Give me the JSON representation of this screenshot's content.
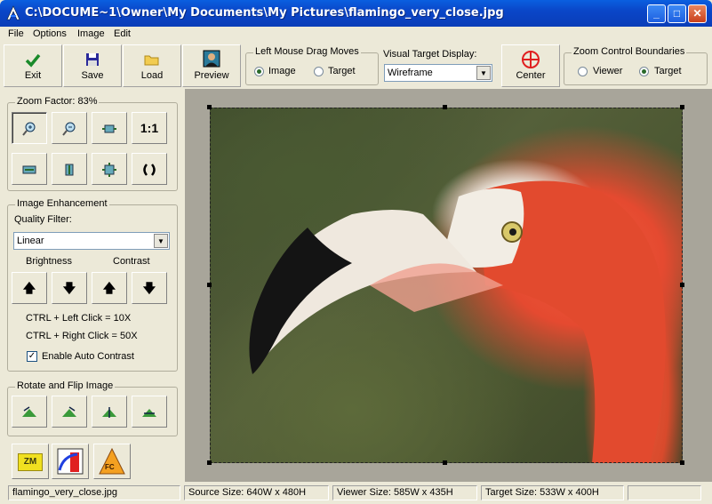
{
  "window": {
    "title": "C:\\DOCUME~1\\Owner\\My Documents\\My Pictures\\flamingo_very_close.jpg"
  },
  "menu": [
    "File",
    "Options",
    "Image",
    "Edit"
  ],
  "toolbar": {
    "exit": "Exit",
    "save": "Save",
    "load": "Load",
    "preview": "Preview",
    "center": "Center"
  },
  "drag_moves": {
    "label": "Left Mouse Drag Moves",
    "options": [
      "Image",
      "Target"
    ],
    "selected": "Image"
  },
  "visual_target": {
    "label": "Visual Target Display:",
    "value": "Wireframe"
  },
  "zoom_bounds": {
    "label": "Zoom Control Boundaries",
    "options": [
      "Viewer",
      "Target"
    ],
    "selected": "Target"
  },
  "zoom": {
    "label": "Zoom Factor: 83%",
    "one_to_one": "1:1"
  },
  "enhance": {
    "label": "Image Enhancement",
    "quality_label": "Quality Filter:",
    "quality_value": "Linear",
    "brightness": "Brightness",
    "contrast": "Contrast",
    "hint1": "CTRL + Left Click = 10X",
    "hint2": "CTRL + Right Click = 50X",
    "auto_contrast": "Enable Auto Contrast",
    "auto_contrast_checked": true
  },
  "rotate": {
    "label": "Rotate and Flip Image"
  },
  "bottom_buttons": {
    "zm": "ZM",
    "fc": "FC"
  },
  "status": {
    "file": "flamingo_very_close.jpg",
    "source": "Source Size: 640W x 480H",
    "viewer": "Viewer Size: 585W x 435H",
    "target": "Target Size: 533W x 400H",
    "extra": ""
  },
  "icons": {
    "exit": "green-checkmark-icon",
    "save": "floppy-disk-icon",
    "load": "folder-icon",
    "preview": "portrait-icon",
    "center": "crosshair-icon"
  },
  "colors": {
    "title_bar": "#0a46c8",
    "viewer_bg": "#a8a59a",
    "center_icon": "#e02020"
  }
}
